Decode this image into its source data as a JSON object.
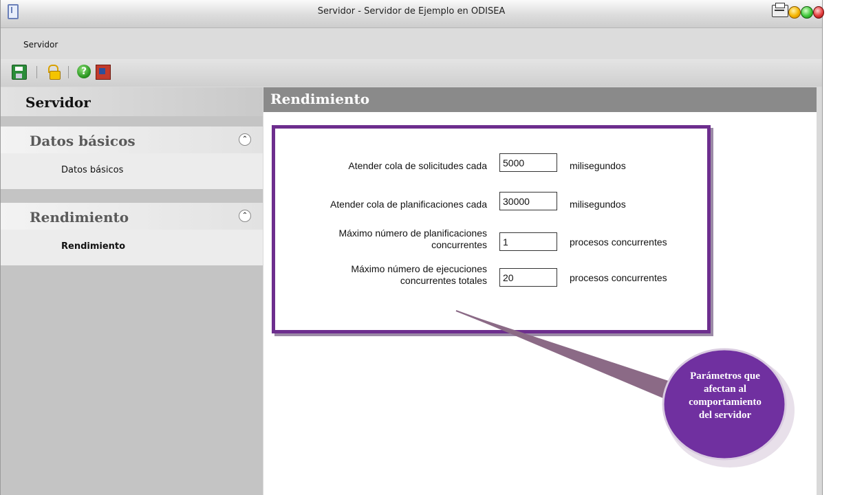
{
  "window": {
    "title": "Servidor - Servidor de Ejemplo en ODISEA",
    "colors": {
      "accent": "#6d2e8e",
      "callout": "#7030a0",
      "header": "#8a8a8a"
    }
  },
  "menubar": {
    "items": [
      "Servidor"
    ]
  },
  "toolbar": {
    "buttons": [
      {
        "name": "save",
        "icon": "save-icon"
      },
      {
        "name": "unlock",
        "icon": "unlock-icon"
      },
      {
        "name": "help",
        "icon": "help-icon",
        "glyph": "?"
      },
      {
        "name": "exit",
        "icon": "exit-icon"
      }
    ]
  },
  "sidebar": {
    "title": "Servidor",
    "groups": [
      {
        "label": "Datos básicos",
        "collapse_glyph": "⌃",
        "items": [
          "Datos básicos"
        ]
      },
      {
        "label": "Rendimiento",
        "collapse_glyph": "⌃",
        "items": [
          "Rendimiento"
        ]
      }
    ]
  },
  "main": {
    "title": "Rendimiento",
    "fields": [
      {
        "label": "Atender cola de solicitudes cada",
        "value": "5000",
        "unit": "milisegundos"
      },
      {
        "label": "Atender cola de planificaciones cada",
        "value": "30000",
        "unit": "milisegundos"
      },
      {
        "label_line1": "Máximo número de planificaciones",
        "label_line2": "concurrentes",
        "value": "1",
        "unit": "procesos concurrentes"
      },
      {
        "label_line1": "Máximo número de ejecuciones",
        "label_line2": "concurrentes totales",
        "value": "20",
        "unit": "procesos concurrentes"
      }
    ]
  },
  "callout": {
    "line1": "Parámetros que",
    "line2": "afectan al",
    "line3": "comportamiento",
    "line4": "del servidor"
  }
}
